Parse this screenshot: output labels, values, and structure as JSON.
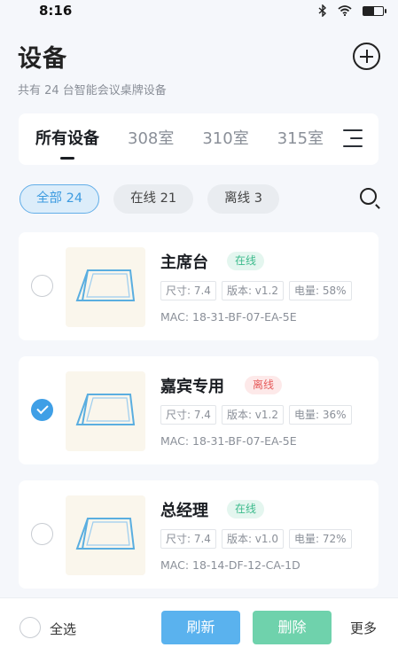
{
  "status_bar": {
    "time": "8:16",
    "icons": [
      "bluetooth-icon",
      "wifi-icon",
      "battery-icon"
    ],
    "battery_level": 0.55
  },
  "header": {
    "title": "设备",
    "subtitle": "共有 24 台智能会议桌牌设备",
    "add_icon": "plus-circle-icon"
  },
  "tabs": [
    {
      "label": "所有设备",
      "active": true
    },
    {
      "label": "308室",
      "active": false
    },
    {
      "label": "310室",
      "active": false
    },
    {
      "label": "315室",
      "active": false
    }
  ],
  "tab_menu_icon": "menu-icon",
  "filters": [
    {
      "label": "全部 24",
      "active": true
    },
    {
      "label": "在线 21",
      "active": false
    },
    {
      "label": "离线 3",
      "active": false
    }
  ],
  "search_icon": "search-icon",
  "devices": [
    {
      "name": "主席台",
      "status": "在线",
      "status_type": "online",
      "checked": false,
      "size": "尺寸: 7.4",
      "version": "版本: v1.2",
      "battery": "电量: 58%",
      "mac": "MAC: 18-31-BF-07-EA-5E"
    },
    {
      "name": "嘉宾专用",
      "status": "离线",
      "status_type": "offline",
      "checked": true,
      "size": "尺寸: 7.4",
      "version": "版本: v1.2",
      "battery": "电量: 36%",
      "mac": "MAC: 18-31-BF-07-EA-5E"
    },
    {
      "name": "总经理",
      "status": "在线",
      "status_type": "online",
      "checked": false,
      "size": "尺寸: 7.4",
      "version": "版本: v1.0",
      "battery": "电量: 72%",
      "mac": "MAC: 18-14-DF-12-CA-1D"
    }
  ],
  "bottom_bar": {
    "select_all": "全选",
    "refresh": "刷新",
    "delete": "删除",
    "more": "更多"
  },
  "colors": {
    "primary": "#5ab2ee",
    "success": "#6fd2ac",
    "online": "#3dbb8c",
    "offline": "#e65c5c",
    "thumb_bg": "#faf6ec"
  }
}
